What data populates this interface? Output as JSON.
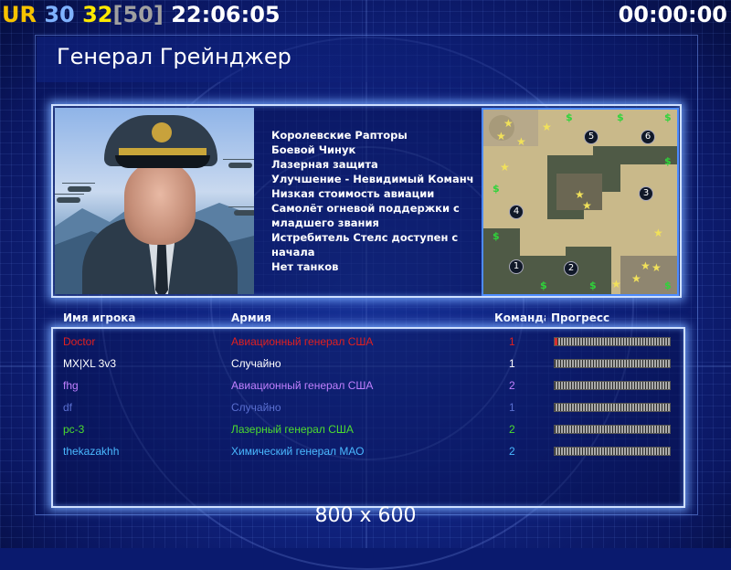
{
  "hud": {
    "ur": "UR",
    "fps": "30",
    "limit": "32",
    "limit_bracket": "[50]",
    "clock": "22:06:05",
    "timer": "00:00:00"
  },
  "general": {
    "title": "Генерал Грейнджер",
    "bonuses": [
      "Королевские Рапторы",
      "Боевой Чинук",
      "Лазерная защита",
      "Улучшение - Невидимый Команч",
      "Низкая стоимость авиации",
      "Самолёт огневой поддержки с",
      " младшего звания",
      "Истребитель Стелс доступен с",
      " начала",
      "Нет танков"
    ]
  },
  "minimap": {
    "slots": [
      "1",
      "2",
      "3",
      "4",
      "5",
      "6"
    ]
  },
  "players_header": {
    "name": "Имя игрока",
    "army": "Армия",
    "team": "Команда",
    "progress": "Прогресс"
  },
  "players": [
    {
      "name": "Doctor",
      "army": "Авиационный генерал США",
      "team": "1",
      "color": "#e02020",
      "progress": 0.02
    },
    {
      "name": "MX|XL 3v3",
      "army": "Случайно",
      "team": "1",
      "color": "#ffffff",
      "progress": 0
    },
    {
      "name": "fhg",
      "army": "Авиационный генерал США",
      "team": "2",
      "color": "#c080ff",
      "progress": 0
    },
    {
      "name": "df",
      "army": "Случайно",
      "team": "1",
      "color": "#5a6fd0",
      "progress": 0
    },
    {
      "name": "pc-3",
      "army": "Лазерный генерал США",
      "team": "2",
      "color": "#4ddc2e",
      "progress": 0
    },
    {
      "name": "thekazakhh",
      "army": "Химический генерал МАО",
      "team": "2",
      "color": "#49b8ff",
      "progress": 0
    }
  ],
  "resolution_label": "800 x 600"
}
